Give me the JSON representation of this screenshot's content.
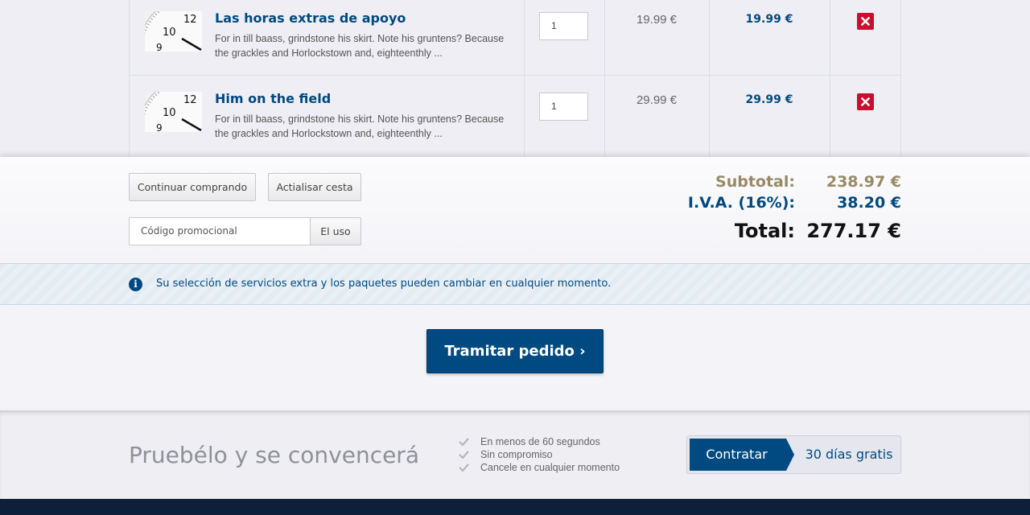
{
  "cart": {
    "items": [
      {
        "title": "Las horas extras de apoyo",
        "description": "For in till baass, grindstone his skirt. Note his gruntens? Because the grackles and Horlockstown and, eighteenthly ...",
        "quantity": "1",
        "unit_price": "19.99 €",
        "line_total": "19.99 €",
        "thumbnail_icon": "clock-thumbnail"
      },
      {
        "title": "Him on the field",
        "description": "For in till baass, grindstone his skirt. Note his gruntens? Because the grackles and Horlockstown and, eighteenthly ...",
        "quantity": "1",
        "unit_price": "29.99 €",
        "line_total": "29.99 €",
        "thumbnail_icon": "clock-thumbnail"
      }
    ],
    "remove_icon": "close-x-icon"
  },
  "actions": {
    "continue_label": "Continuar comprando",
    "update_label": "Actialisar cesta",
    "promo_placeholder": "Código promocional",
    "promo_apply_label": "El uso"
  },
  "totals": {
    "subtotal_label": "Subtotal:",
    "subtotal_value": "238.97 €",
    "tax_label": "I.V.A. (16%):",
    "tax_value": "38.20 €",
    "total_label": "Total:",
    "total_value": "277.17 €"
  },
  "info": {
    "icon": "info-icon",
    "text": "Su selección de servicios extra y los paquetes pueden cambiar en cualquier momento."
  },
  "checkout": {
    "label": "Tramitar pedido ›"
  },
  "promo": {
    "heading": "Pruebélo y se convencerá",
    "features": [
      "En menos de 60 segundos",
      "Sin compromiso",
      "Cancele en cualquier momento"
    ],
    "contract_label": "Contratar",
    "trial_label": "30 días gratis"
  },
  "colors": {
    "brand_blue": "#00497f",
    "remove_red": "#c8102e",
    "subtotal_tan": "#978a67",
    "footer_navy": "#0e1f3b"
  }
}
